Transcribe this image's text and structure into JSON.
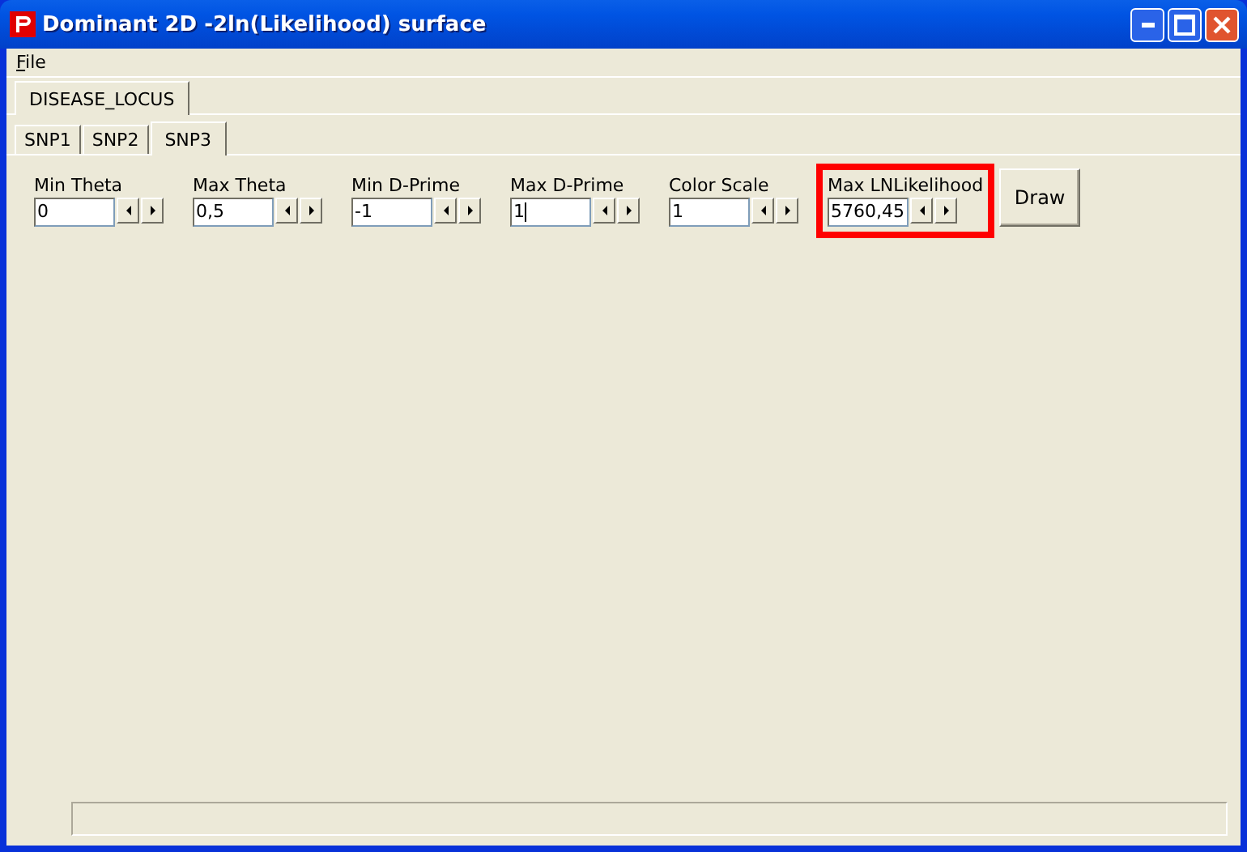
{
  "window": {
    "title": "Dominant 2D -2ln(Likelihood) surface"
  },
  "menu": [
    {
      "label": "File"
    }
  ],
  "outer_tabs": [
    {
      "label": "DISEASE_LOCUS",
      "selected": true
    }
  ],
  "tabs": [
    {
      "label": "SNP1",
      "selected": false
    },
    {
      "label": "SNP2",
      "selected": false
    },
    {
      "label": "SNP3",
      "selected": true
    }
  ],
  "fields": [
    {
      "label": "Min Theta",
      "value": "0",
      "focused": false,
      "highlighted": false
    },
    {
      "label": "Max Theta",
      "value": "0,5",
      "focused": false,
      "highlighted": false
    },
    {
      "label": "Min D-Prime",
      "value": "-1",
      "focused": false,
      "highlighted": false
    },
    {
      "label": "Max D-Prime",
      "value": "1",
      "focused": true,
      "highlighted": false
    },
    {
      "label": "Color Scale",
      "value": "1",
      "focused": false,
      "highlighted": false
    },
    {
      "label": "Max LNLikelihood",
      "value": "5760,45",
      "focused": false,
      "highlighted": true
    }
  ],
  "buttons": [
    {
      "label": "Draw"
    }
  ]
}
